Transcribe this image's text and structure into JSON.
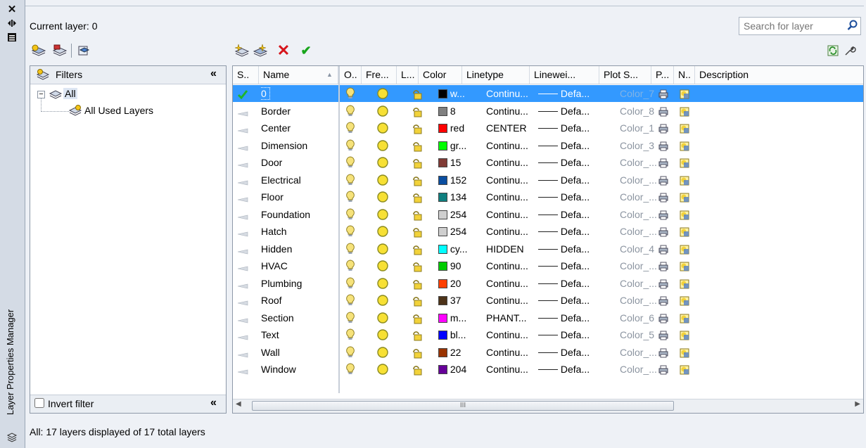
{
  "panel": {
    "title": "Layer Properties Manager",
    "current_layer": "Current layer: 0",
    "search_placeholder": "Search for layer"
  },
  "filters": {
    "header": "Filters",
    "tree": [
      {
        "label": "All"
      },
      {
        "label": "All Used Layers"
      }
    ],
    "invert_filter_label": "Invert filter",
    "invert_filter_checked": false
  },
  "table": {
    "columns": [
      "S..",
      "Name",
      "O..",
      "Fre...",
      "L...",
      "Color",
      "Linetype",
      "Linewei...",
      "Plot S...",
      "P...",
      "N..",
      "Description"
    ],
    "rows": [
      {
        "name": "0",
        "color_label": "w...",
        "color_hex": "#000000",
        "linetype": "Continu...",
        "lineweight": "Defa...",
        "plot_style": "Color_7",
        "current": true
      },
      {
        "name": "Border",
        "color_label": "8",
        "color_hex": "#808080",
        "linetype": "Continu...",
        "lineweight": "Defa...",
        "plot_style": "Color_8"
      },
      {
        "name": "Center",
        "color_label": "red",
        "color_hex": "#ff0000",
        "linetype": "CENTER",
        "lineweight": "Defa...",
        "plot_style": "Color_1"
      },
      {
        "name": "Dimension",
        "color_label": "gr...",
        "color_hex": "#00ff00",
        "linetype": "Continu...",
        "lineweight": "Defa...",
        "plot_style": "Color_3"
      },
      {
        "name": "Door",
        "color_label": "15",
        "color_hex": "#803a35",
        "linetype": "Continu...",
        "lineweight": "Defa...",
        "plot_style": "Color_..."
      },
      {
        "name": "Electrical",
        "color_label": "152",
        "color_hex": "#0b4ea0",
        "linetype": "Continu...",
        "lineweight": "Defa...",
        "plot_style": "Color_..."
      },
      {
        "name": "Floor",
        "color_label": "134",
        "color_hex": "#0f7f7f",
        "linetype": "Continu...",
        "lineweight": "Defa...",
        "plot_style": "Color_..."
      },
      {
        "name": "Foundation",
        "color_label": "254",
        "color_hex": "#cfcfcf",
        "linetype": "Continu...",
        "lineweight": "Defa...",
        "plot_style": "Color_..."
      },
      {
        "name": "Hatch",
        "color_label": "254",
        "color_hex": "#cfcfcf",
        "linetype": "Continu...",
        "lineweight": "Defa...",
        "plot_style": "Color_..."
      },
      {
        "name": "Hidden",
        "color_label": "cy...",
        "color_hex": "#00ffff",
        "linetype": "HIDDEN",
        "lineweight": "Defa...",
        "plot_style": "Color_4"
      },
      {
        "name": "HVAC",
        "color_label": "90",
        "color_hex": "#00cc00",
        "linetype": "Continu...",
        "lineweight": "Defa...",
        "plot_style": "Color_..."
      },
      {
        "name": "Plumbing",
        "color_label": "20",
        "color_hex": "#ff3f00",
        "linetype": "Continu...",
        "lineweight": "Defa...",
        "plot_style": "Color_..."
      },
      {
        "name": "Roof",
        "color_label": "37",
        "color_hex": "#4d3319",
        "linetype": "Continu...",
        "lineweight": "Defa...",
        "plot_style": "Color_..."
      },
      {
        "name": "Section",
        "color_label": "m...",
        "color_hex": "#ff00ff",
        "linetype": "PHANT...",
        "lineweight": "Defa...",
        "plot_style": "Color_6"
      },
      {
        "name": "Text",
        "color_label": "bl...",
        "color_hex": "#0000ff",
        "linetype": "Continu...",
        "lineweight": "Defa...",
        "plot_style": "Color_5"
      },
      {
        "name": "Wall",
        "color_label": "22",
        "color_hex": "#993300",
        "linetype": "Continu...",
        "lineweight": "Defa...",
        "plot_style": "Color_..."
      },
      {
        "name": "Window",
        "color_label": "204",
        "color_hex": "#660099",
        "linetype": "Continu...",
        "lineweight": "Defa...",
        "plot_style": "Color_..."
      }
    ],
    "scroll_center_label": "III"
  },
  "status": "All: 17 layers displayed of 17 total layers"
}
